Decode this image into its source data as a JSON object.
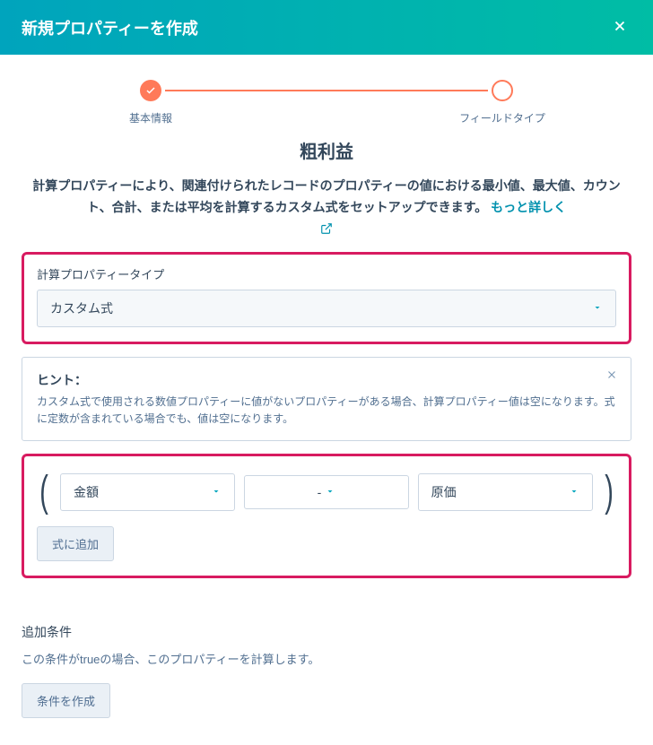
{
  "header": {
    "title": "新規プロパティーを作成"
  },
  "stepper": {
    "step1": "基本情報",
    "step2": "フィールドタイプ"
  },
  "section_title": "粗利益",
  "description_lead": "計算プロパティーにより、関連付けられたレコードのプロパティーの値における最小値、最大値、カウント、合計、または平均を計算するカスタム式をセットアップできます。 ",
  "learn_more": "もっと詳しく",
  "calc_type": {
    "label": "計算プロパティータイプ",
    "value": "カスタム式"
  },
  "hint": {
    "title": "ヒント：",
    "body": "カスタム式で使用される数値プロパティーに値がないプロパティーがある場合、計算プロパティー値は空になります。式に定数が含まれている場合でも、値は空になります。"
  },
  "formula": {
    "field1": "金額",
    "operator": "-",
    "field2": "原価",
    "add_button": "式に追加"
  },
  "extra": {
    "title": "追加条件",
    "desc": "この条件がtrueの場合、このプロパティーを計算します。",
    "button": "条件を作成"
  }
}
